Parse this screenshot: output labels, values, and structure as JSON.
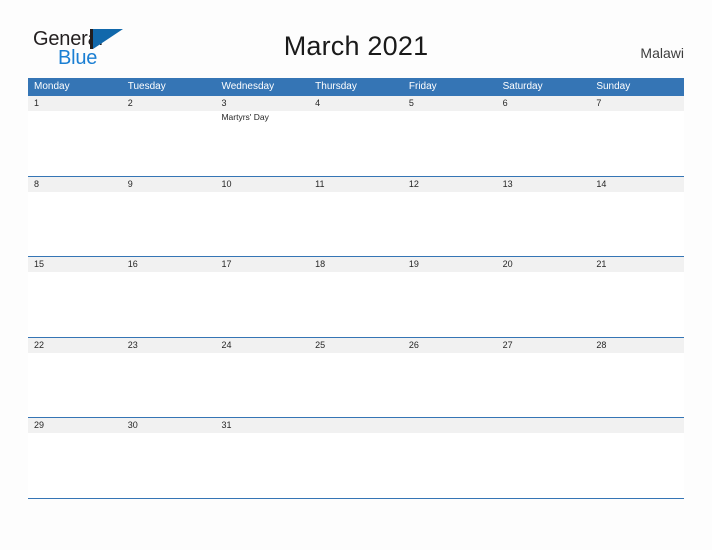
{
  "brand": {
    "name_part1": "General",
    "name_part2": "Blue",
    "triangle_color": "#1168ab",
    "blue_text_color": "#1b7fd3"
  },
  "header": {
    "title": "March 2021",
    "country": "Malawi",
    "accent_color": "#3575b5",
    "band_color": "#f1f1f1"
  },
  "calendar": {
    "month": "March",
    "year": "2021",
    "weekday_headers": [
      "Monday",
      "Tuesday",
      "Wednesday",
      "Thursday",
      "Friday",
      "Saturday",
      "Sunday"
    ],
    "weeks": [
      {
        "days": [
          {
            "num": "1",
            "holiday": ""
          },
          {
            "num": "2",
            "holiday": ""
          },
          {
            "num": "3",
            "holiday": "Martyrs' Day"
          },
          {
            "num": "4",
            "holiday": ""
          },
          {
            "num": "5",
            "holiday": ""
          },
          {
            "num": "6",
            "holiday": ""
          },
          {
            "num": "7",
            "holiday": ""
          }
        ]
      },
      {
        "days": [
          {
            "num": "8",
            "holiday": ""
          },
          {
            "num": "9",
            "holiday": ""
          },
          {
            "num": "10",
            "holiday": ""
          },
          {
            "num": "11",
            "holiday": ""
          },
          {
            "num": "12",
            "holiday": ""
          },
          {
            "num": "13",
            "holiday": ""
          },
          {
            "num": "14",
            "holiday": ""
          }
        ]
      },
      {
        "days": [
          {
            "num": "15",
            "holiday": ""
          },
          {
            "num": "16",
            "holiday": ""
          },
          {
            "num": "17",
            "holiday": ""
          },
          {
            "num": "18",
            "holiday": ""
          },
          {
            "num": "19",
            "holiday": ""
          },
          {
            "num": "20",
            "holiday": ""
          },
          {
            "num": "21",
            "holiday": ""
          }
        ]
      },
      {
        "days": [
          {
            "num": "22",
            "holiday": ""
          },
          {
            "num": "23",
            "holiday": ""
          },
          {
            "num": "24",
            "holiday": ""
          },
          {
            "num": "25",
            "holiday": ""
          },
          {
            "num": "26",
            "holiday": ""
          },
          {
            "num": "27",
            "holiday": ""
          },
          {
            "num": "28",
            "holiday": ""
          }
        ]
      },
      {
        "days": [
          {
            "num": "29",
            "holiday": ""
          },
          {
            "num": "30",
            "holiday": ""
          },
          {
            "num": "31",
            "holiday": ""
          },
          {
            "num": "",
            "holiday": ""
          },
          {
            "num": "",
            "holiday": ""
          },
          {
            "num": "",
            "holiday": ""
          },
          {
            "num": "",
            "holiday": ""
          }
        ]
      }
    ]
  }
}
